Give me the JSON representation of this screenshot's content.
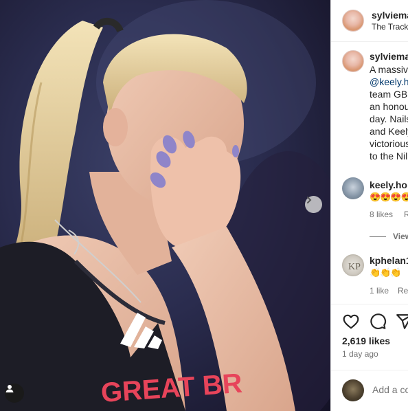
{
  "post": {
    "author": "sylviemacnailtech",
    "location": "The Track",
    "author_short_header": "sylviema",
    "location_short": "The Track",
    "caption_author_short": "sylviema",
    "caption_lines": [
      "A massiv",
      "@keely.h",
      "team GB",
      "an honou",
      "day. Nails",
      "and Keely",
      "victorious",
      "to the Nil"
    ],
    "next_icon": "chevron-right-icon",
    "tag_icon": "user-tag-icon"
  },
  "comments": [
    {
      "user_short": "keely.ho",
      "text": "😍😍😍😍",
      "likes": "8 likes",
      "reply_short": "R"
    },
    {
      "user_short": "kphelan1",
      "text": "👏👏👏",
      "likes": "1 like",
      "reply_short": "Re"
    }
  ],
  "view_replies_short": "View",
  "engagement": {
    "likes": "2,619 likes",
    "time_ago": "1 day ago"
  },
  "comment_box": {
    "placeholder_short": "Add a co"
  },
  "photo": {
    "shirt_text": "GREAT BR"
  },
  "colors": {
    "accent_link": "#00376b",
    "muted": "#737373",
    "divider": "#efefef"
  }
}
